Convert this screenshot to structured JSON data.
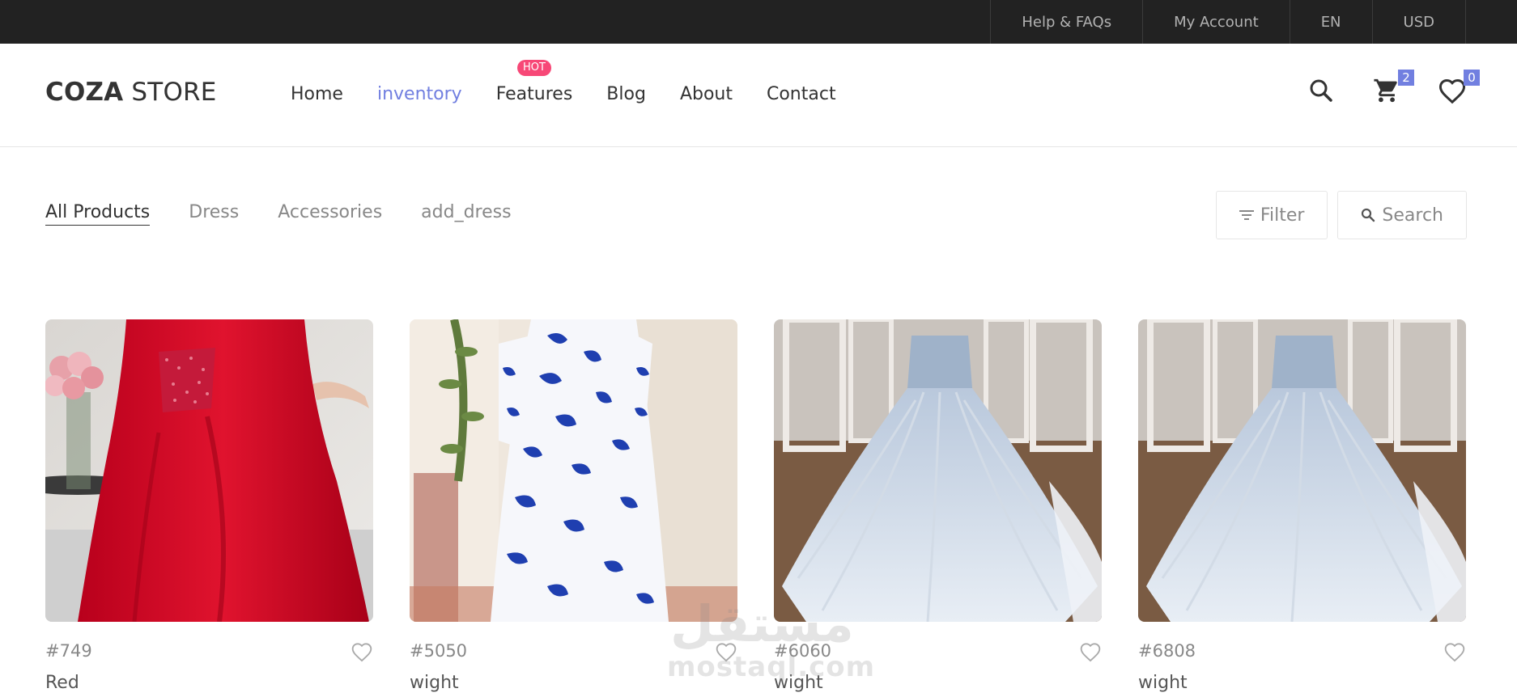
{
  "topbar": {
    "links": [
      "Help & FAQs",
      "My Account",
      "EN",
      "USD"
    ]
  },
  "header": {
    "logo_bold": "COZA",
    "logo_rest": " STORE",
    "nav": [
      {
        "label": "Home",
        "active": false
      },
      {
        "label": "inventory",
        "active": true
      },
      {
        "label": "Features",
        "active": false,
        "badge": "HOT"
      },
      {
        "label": "Blog",
        "active": false
      },
      {
        "label": "About",
        "active": false
      },
      {
        "label": "Contact",
        "active": false
      }
    ],
    "cart_count": "2",
    "wishlist_count": "0"
  },
  "filters": {
    "categories": [
      {
        "label": "All Products",
        "active": true
      },
      {
        "label": "Dress",
        "active": false
      },
      {
        "label": "Accessories",
        "active": false
      },
      {
        "label": "add_dress",
        "active": false
      }
    ],
    "filter_label": "Filter",
    "search_label": "Search"
  },
  "products": [
    {
      "id": "#749",
      "name": "Red",
      "image": "red-satin-dress"
    },
    {
      "id": "#5050",
      "name": "wight",
      "image": "blue-floral-maxi-dress"
    },
    {
      "id": "#6060",
      "name": "wight",
      "image": "white-ball-gown"
    },
    {
      "id": "#6808",
      "name": "wight",
      "image": "white-ball-gown"
    }
  ],
  "watermark": {
    "arabic": "مستقل",
    "latin": "mostaql.com"
  },
  "colors": {
    "accent": "#717fe0",
    "hot": "#f74877",
    "topbar": "#222222"
  }
}
